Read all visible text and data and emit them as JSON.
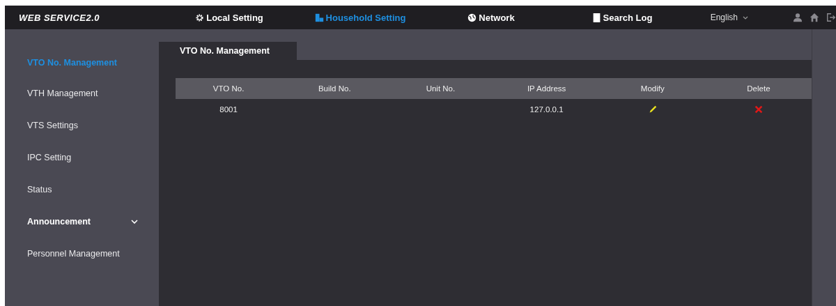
{
  "header": {
    "logo": "WEB SERVICE2.0",
    "nav": [
      {
        "label": "Local Setting",
        "selected": false
      },
      {
        "label": "Household Setting",
        "selected": true
      },
      {
        "label": "Network",
        "selected": false
      },
      {
        "label": "Search Log",
        "selected": false
      }
    ],
    "language": "English"
  },
  "sidebar": {
    "items": [
      {
        "label": "VTO No. Management",
        "selected": true,
        "kind": "item"
      },
      {
        "label": "VTH Management",
        "selected": false,
        "kind": "item"
      },
      {
        "label": "VTS Settings",
        "selected": false,
        "kind": "item"
      },
      {
        "label": "IPC Setting",
        "selected": false,
        "kind": "item"
      },
      {
        "label": "Status",
        "selected": false,
        "kind": "item"
      },
      {
        "label": "Announcement",
        "selected": false,
        "kind": "group",
        "expanded": false
      },
      {
        "label": "Personnel Management",
        "selected": false,
        "kind": "item"
      }
    ]
  },
  "tabs": [
    {
      "label": "VTO No. Management",
      "selected": true
    }
  ],
  "table": {
    "columns": [
      "VTO No.",
      "Build No.",
      "Unit No.",
      "IP Address",
      "Modify",
      "Delete"
    ],
    "rows": [
      {
        "vto_no": "8001",
        "build_no": "",
        "unit_no": "",
        "ip_address": "127.0.0.1"
      }
    ]
  }
}
